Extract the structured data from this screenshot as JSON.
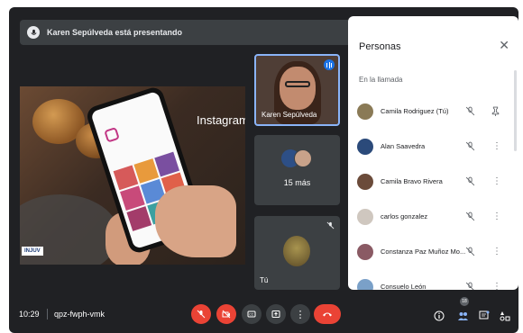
{
  "banner": {
    "text": "Karen Sepúlveda está presentando",
    "icon": "mic-icon"
  },
  "presentation": {
    "word": "Instagram",
    "logo_text": "INJUV"
  },
  "tiles": {
    "presenter": {
      "name": "Karen Sepúlveda",
      "speaking_icon": "audio-level-icon"
    },
    "more": {
      "label": "15 más"
    },
    "self": {
      "label": "Tú",
      "muted_icon": "mic-off-icon"
    }
  },
  "people_panel": {
    "title": "Personas",
    "close_icon": "close-icon",
    "section": "En la llamada",
    "participants": [
      {
        "name": "Camila Rodriguez (Tú)",
        "color": "#8a7a56",
        "action_icon": "pin-icon"
      },
      {
        "name": "Alan Saavedra",
        "color": "#2b4a7a",
        "action_icon": "more-vert-icon"
      },
      {
        "name": "Camila Bravo Rivera",
        "color": "#6b4b3a",
        "action_icon": "more-vert-icon"
      },
      {
        "name": "carlos gonzalez",
        "color": "#cfc7bf",
        "action_icon": "more-vert-icon"
      },
      {
        "name": "Constanza Paz Muñoz Mo...",
        "color": "#8a5a64",
        "action_icon": "more-vert-icon"
      },
      {
        "name": "Consuelo León",
        "color": "#7aa0c8",
        "action_icon": "more-vert-icon"
      }
    ]
  },
  "bottom_bar": {
    "time": "10:29",
    "meeting_code": "qpz-fwph-vmk",
    "people_count": "18"
  },
  "colors": {
    "bar_bg": "#202124",
    "danger": "#ea4335",
    "accent": "#8ab4f8"
  }
}
